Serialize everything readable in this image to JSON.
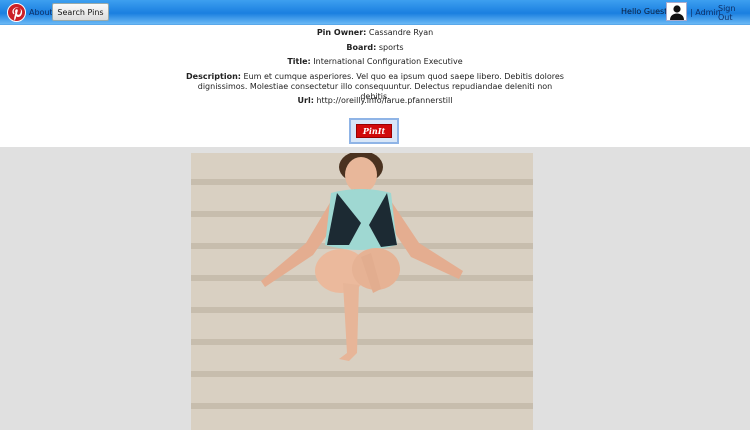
{
  "nav": {
    "about": "About",
    "search_pins": "Search Pins",
    "greeting": "Hello Guest!",
    "admin": "| Admin",
    "sign_out": "Sign Out"
  },
  "pin": {
    "owner_label": "Pin Owner:",
    "owner": "Cassandre Ryan",
    "board_label": "Board:",
    "board": "sports",
    "title_label": "Title:",
    "title": "International Configuration Executive",
    "description_label": "Description:",
    "description": "Eum et cumque asperiores. Vel quo ea ipsum quod saepe libero. Debitis dolores dignissimos. Molestiae consectetur illo consequuntur. Delectus repudiandae deleniti non debitis.",
    "url_label": "Url:",
    "url": "http://oreilly.info/larue.pfannerstill",
    "pinit": "PinIt"
  },
  "colors": {
    "header_blue": "#1a7fe0",
    "pinterest_red": "#cb2027",
    "pinit_red": "#d10a0a"
  }
}
